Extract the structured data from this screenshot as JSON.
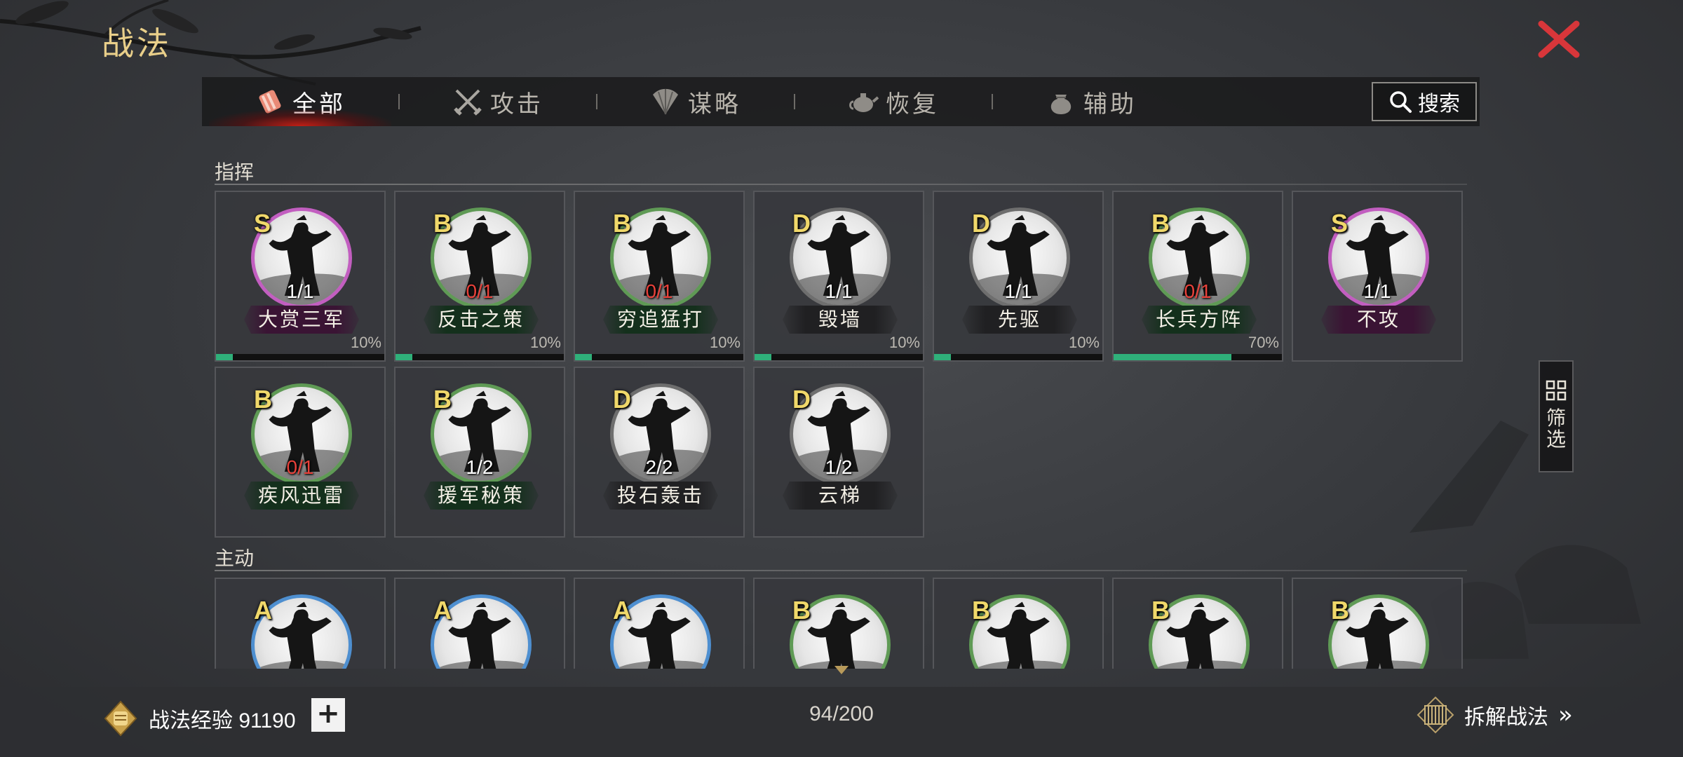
{
  "header": {
    "title": "战法",
    "close_icon": "close-x-icon",
    "close_color": "#d8363a"
  },
  "tabs": [
    {
      "label": "全部",
      "icon": "bundle-icon",
      "active": true
    },
    {
      "label": "攻击",
      "icon": "crossed-swords-icon",
      "active": false
    },
    {
      "label": "谋略",
      "icon": "fan-icon",
      "active": false
    },
    {
      "label": "恢复",
      "icon": "teapot-icon",
      "active": false
    },
    {
      "label": "辅助",
      "icon": "pouch-icon",
      "active": false
    }
  ],
  "search": {
    "label": "搜索",
    "icon": "search-icon"
  },
  "filter": {
    "label": "筛选",
    "icon": "grid-icon"
  },
  "sections": [
    {
      "title": "指挥",
      "cards": [
        {
          "grade": "S",
          "count": "1/1",
          "count_red": false,
          "name": "大赏三军",
          "percent": "10%",
          "progress": 0.1
        },
        {
          "grade": "B",
          "count": "0/1",
          "count_red": true,
          "name": "反击之策",
          "percent": "10%",
          "progress": 0.1
        },
        {
          "grade": "B",
          "count": "0/1",
          "count_red": true,
          "name": "穷追猛打",
          "percent": "10%",
          "progress": 0.1
        },
        {
          "grade": "D",
          "count": "1/1",
          "count_red": false,
          "name": "毁墙",
          "percent": "10%",
          "progress": 0.1
        },
        {
          "grade": "D",
          "count": "1/1",
          "count_red": false,
          "name": "先驱",
          "percent": "10%",
          "progress": 0.1
        },
        {
          "grade": "B",
          "count": "0/1",
          "count_red": true,
          "name": "长兵方阵",
          "percent": "70%",
          "progress": 0.7
        },
        {
          "grade": "S",
          "count": "1/1",
          "count_red": false,
          "name": "不攻",
          "percent": "",
          "progress": null
        },
        {
          "grade": "B",
          "count": "0/1",
          "count_red": true,
          "name": "疾风迅雷",
          "percent": "",
          "progress": null
        },
        {
          "grade": "B",
          "count": "1/2",
          "count_red": false,
          "name": "援军秘策",
          "percent": "",
          "progress": null
        },
        {
          "grade": "D",
          "count": "2/2",
          "count_red": false,
          "name": "投石轰击",
          "percent": "",
          "progress": null
        },
        {
          "grade": "D",
          "count": "1/2",
          "count_red": false,
          "name": "云梯",
          "percent": "",
          "progress": null
        }
      ]
    },
    {
      "title": "主动",
      "cards": [
        {
          "grade": "A",
          "count": "",
          "count_red": false,
          "name": "",
          "percent": "",
          "progress": null
        },
        {
          "grade": "A",
          "count": "",
          "count_red": false,
          "name": "",
          "percent": "",
          "progress": null
        },
        {
          "grade": "A",
          "count": "",
          "count_red": false,
          "name": "",
          "percent": "",
          "progress": null
        },
        {
          "grade": "B",
          "count": "",
          "count_red": false,
          "name": "",
          "percent": "",
          "progress": null
        },
        {
          "grade": "B",
          "count": "",
          "count_red": false,
          "name": "",
          "percent": "",
          "progress": null
        },
        {
          "grade": "B",
          "count": "",
          "count_red": false,
          "name": "",
          "percent": "",
          "progress": null
        },
        {
          "grade": "B",
          "count": "",
          "count_red": false,
          "name": "",
          "percent": "",
          "progress": null
        }
      ]
    }
  ],
  "grade_colors": {
    "S": "#c25ec0",
    "A": "#4e8fd0",
    "B": "#5f9a55",
    "D": "#6e6e6e"
  },
  "footer": {
    "exp_label": "战法经验 91190",
    "exp_icon": "fist-badge-icon",
    "plus_label": "+",
    "capacity": "94/200",
    "dismantle_label": "拆解战法",
    "dismantle_icon": "scroll-icon",
    "dismantle_arrow": "»"
  }
}
